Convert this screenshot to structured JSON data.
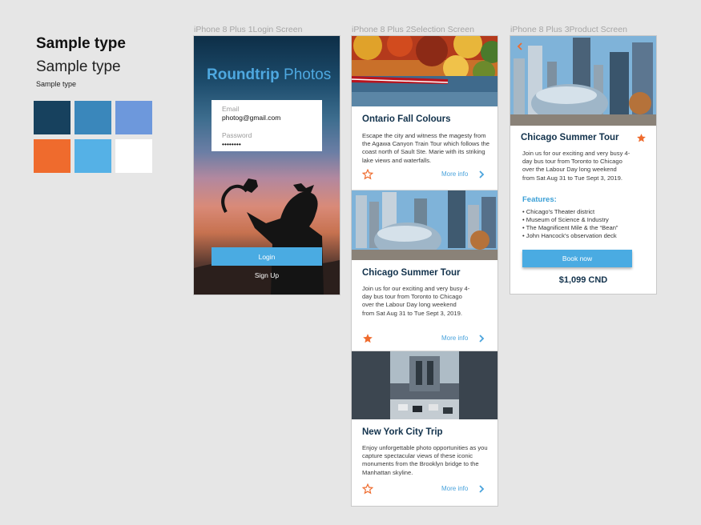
{
  "typography": {
    "heading_bold": "Sample type",
    "heading_regular": "Sample type",
    "body_small": "Sample type"
  },
  "palette": [
    "#17415e",
    "#3a87bb",
    "#6d98dc",
    "#ef6b2d",
    "#55b1e6",
    "#ffffff"
  ],
  "frames": {
    "login": {
      "label": "iPhone 8 Plus 1Login Screen",
      "brand_bold": "Roundtrip",
      "brand_light": " Photos",
      "email_label": "Email",
      "email_value": "photog@gmail.com",
      "password_label": "Password",
      "password_value": "••••••••",
      "login_button": "Login",
      "signup_link": "Sign Up"
    },
    "selection": {
      "label": "iPhone 8 Plus 2Selection Screen",
      "cards": [
        {
          "title": "Ontario Fall Colours",
          "description": "Escape the city and witness the magesty from the Agawa Canyon Train Tour which follows the coast north of Sault Ste. Marie with its striking lake views and waterfalls.",
          "more_info": "More info",
          "favorited": false
        },
        {
          "title": "Chicago Summer Tour",
          "description": "Join us for our exciting and very busy 4-day bus tour from Toronto to Chicago over the Labour Day long weekend from Sat Aug 31 to Tue Sept 3, 2019.",
          "more_info": "More info",
          "favorited": true
        },
        {
          "title": "New York City Trip",
          "description": "Enjoy unforgettable photo opportunities as you capture spectacular views of these iconic monuments from the Brooklyn bridge to the Manhattan skyline.",
          "more_info": "More info",
          "favorited": false
        }
      ]
    },
    "product": {
      "label": "iPhone 8 Plus 3Product Screen",
      "title": "Chicago Summer Tour",
      "favorited": true,
      "description": "Join us for our exciting and very busy 4-day bus tour from Toronto to Chicago over the Labour Day long weekend from Sat Aug 31 to Tue Sept 3, 2019.",
      "features_heading": "Features:",
      "features": [
        "Chicago's Theater district",
        "Museum of Science & Industry",
        "The Magnificent Mile & the “Bean”",
        "John Hancock's observation deck"
      ],
      "book_button": "Book now",
      "price": "$1,099 CND"
    }
  },
  "icons": {
    "star_outline": "star-outline-icon",
    "star_filled": "star-filled-icon",
    "chevron": "chevron-right-icon",
    "back": "back-arrow-icon"
  },
  "colors": {
    "accent_blue": "#4aabe2",
    "accent_orange": "#ef6b2d",
    "title_navy": "#12324c"
  }
}
